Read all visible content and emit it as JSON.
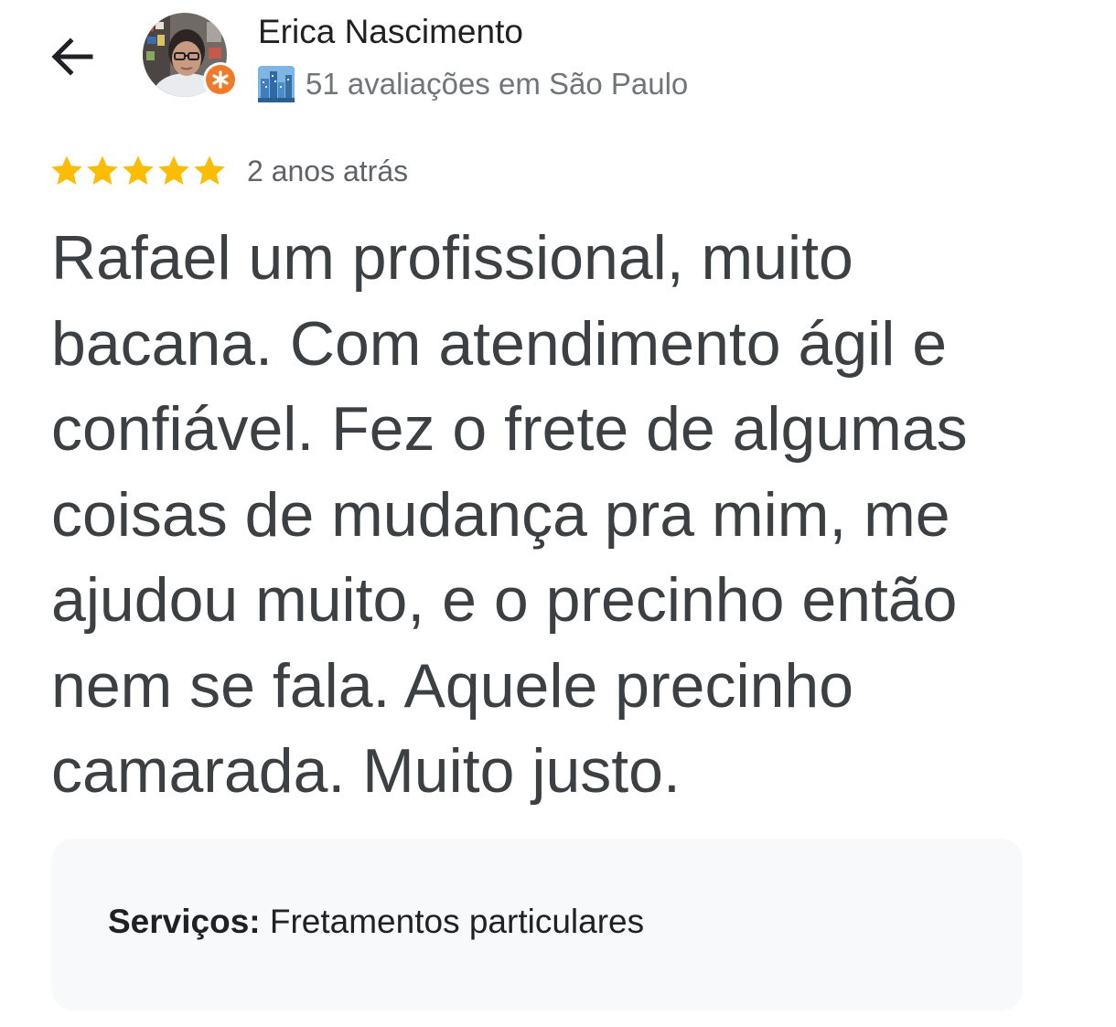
{
  "header": {
    "back_icon": "arrow-left-icon",
    "avatar_icon": "profile-photo",
    "local_guide_badge_icon": "local-guide-star-badge",
    "user_name": "Erica Nascimento",
    "city_icon": "cityscape-emoji",
    "reviews_summary": "51 avaliações em São Paulo"
  },
  "review": {
    "rating": 5,
    "rating_max": 5,
    "star_color": "#fbbc04",
    "date": "2 anos atrás",
    "text": "Rafael um profissional, muito bacana. Com atendimento ágil e confiável. Fez o frete de algumas coisas de mudança pra mim, me ajudou muito, e o precinho então nem se fala. Aquele precinho camarada. Muito justo."
  },
  "services": {
    "label": "Serviços:",
    "value": " Fretamentos particulares"
  },
  "colors": {
    "badge_orange": "#f07a2c",
    "card_background": "#f8f9fa"
  }
}
